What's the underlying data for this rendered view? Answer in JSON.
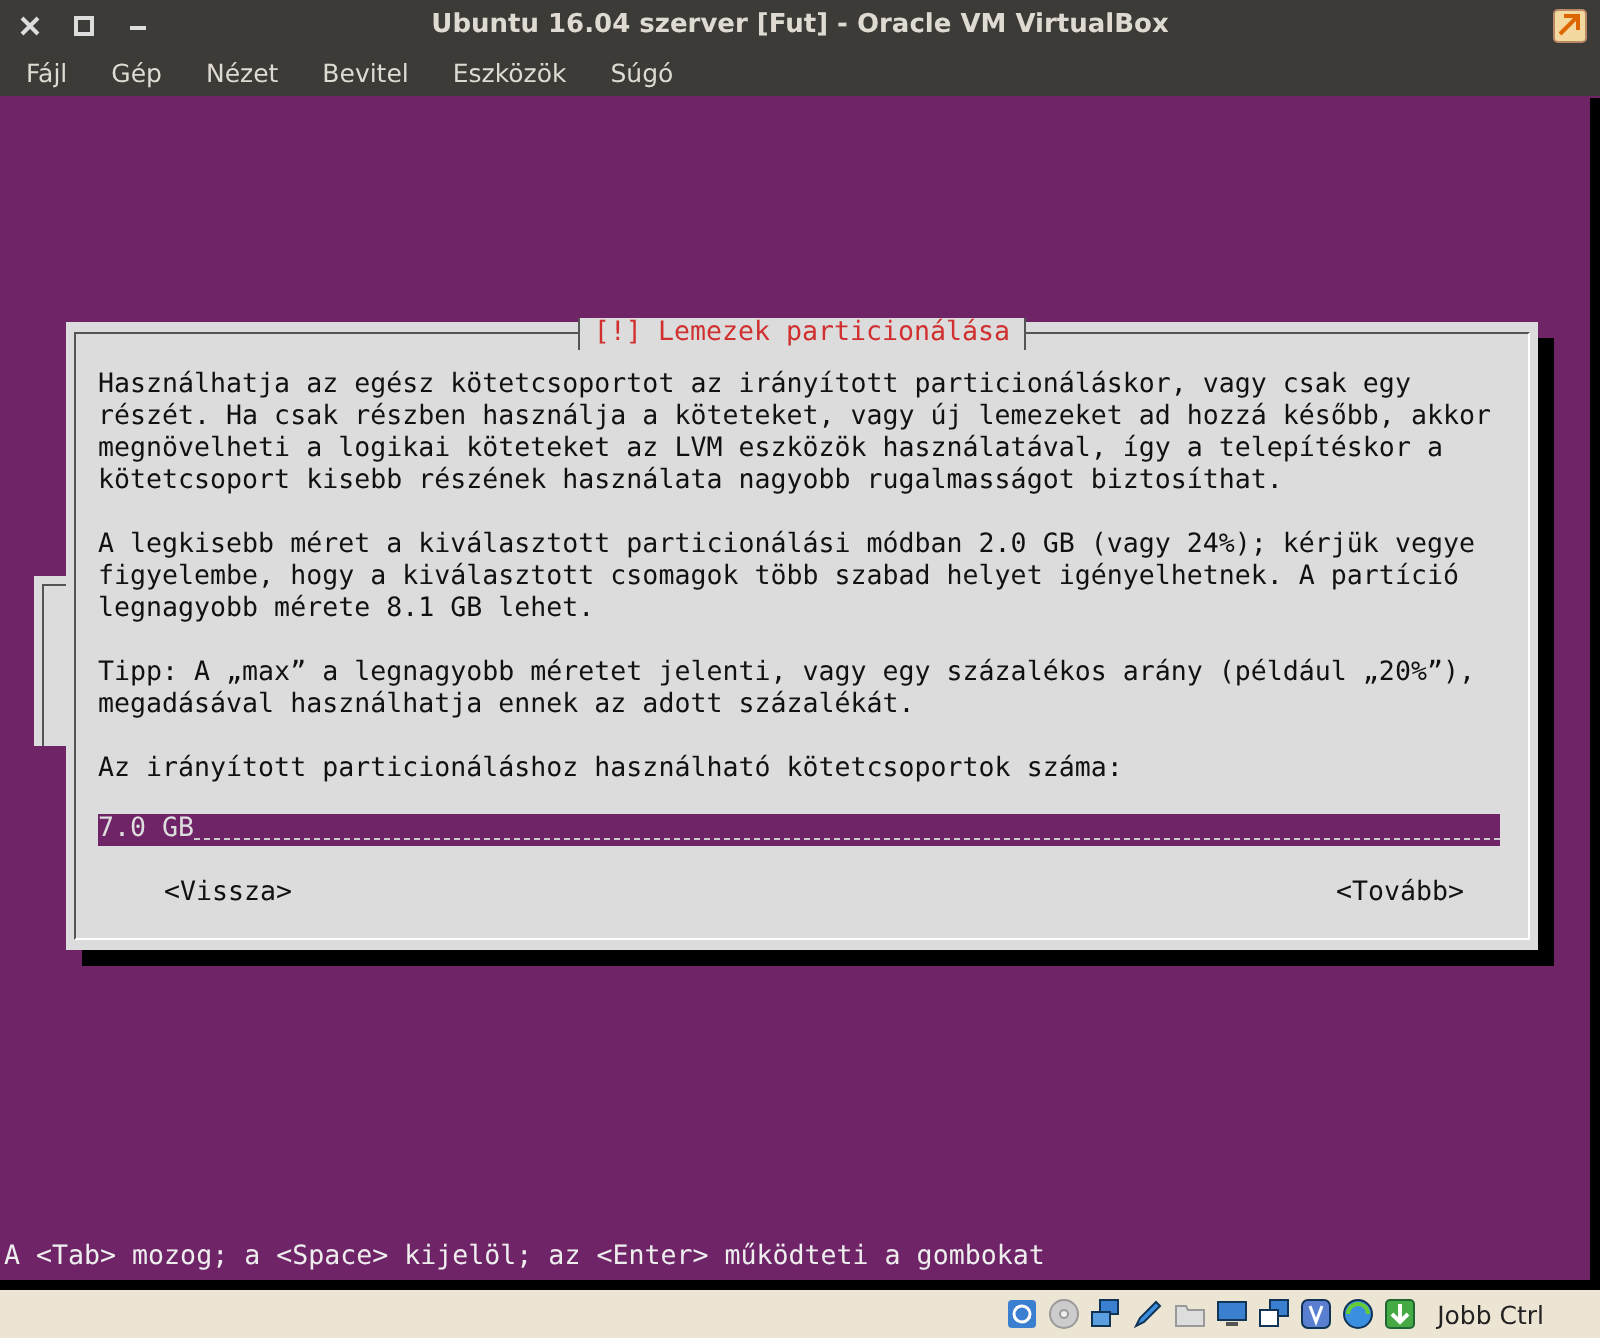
{
  "window": {
    "title": "Ubuntu 16.04 szerver [Fut] - Oracle VM VirtualBox"
  },
  "menu": [
    "Fájl",
    "Gép",
    "Nézet",
    "Bevitel",
    "Eszközök",
    "Súgó"
  ],
  "dialog": {
    "title": "[!] Lemezek particionálása",
    "paragraphs": [
      [
        "Használhatja az egész kötetcsoportot az irányított particionáláskor, vagy csak egy",
        "részét. Ha csak részben használja a köteteket, vagy új lemezeket ad hozzá később, akkor",
        "megnövelheti a logikai köteteket az LVM eszközök használatával, így a telepítéskor a",
        "kötetcsoport kisebb részének használata nagyobb rugalmasságot biztosíthat."
      ],
      [
        "A legkisebb méret a kiválasztott particionálási módban 2.0 GB (vagy 24%); kérjük vegye",
        "figyelembe, hogy a kiválasztott csomagok több szabad helyet igényelhetnek. A partíció",
        "legnagyobb mérete 8.1 GB lehet."
      ],
      [
        "Tipp: A „max” a legnagyobb méretet jelenti, vagy egy százalékos arány (például „20%”),",
        "megadásával használhatja ennek az adott százalékát."
      ],
      [
        "Az irányított particionáláshoz használható kötetcsoportok száma:"
      ]
    ],
    "field": {
      "value": "7.0 GB"
    },
    "buttons": [
      "<Vissza>",
      "<Tovább>"
    ]
  },
  "hint": "A <Tab> mozog; a <Space> kijelöl; az <Enter> működteti a gombokat",
  "status_bar": {
    "host_key": "Jobb Ctrl"
  }
}
